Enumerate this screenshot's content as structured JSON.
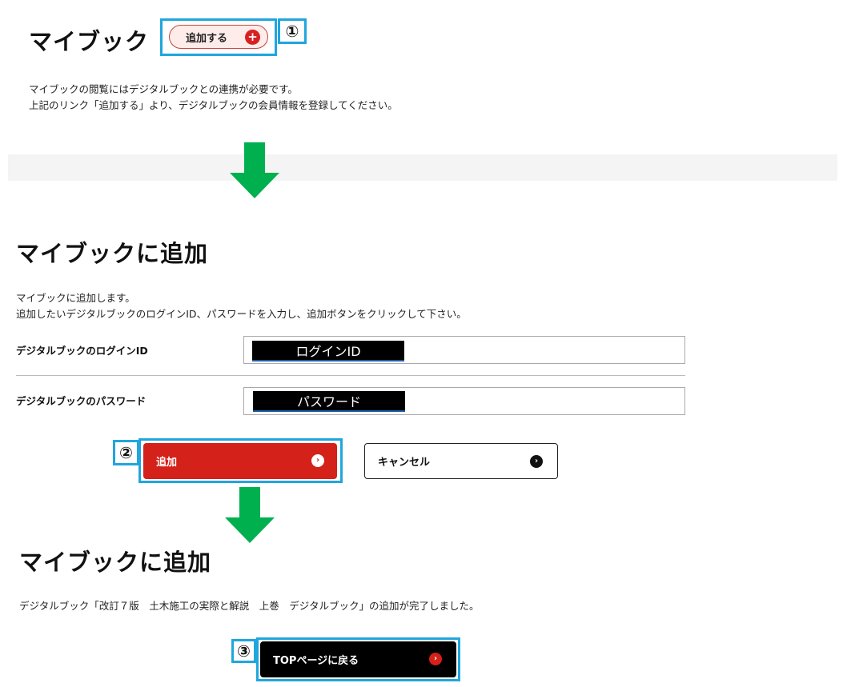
{
  "step1": {
    "title": "マイブック",
    "add_button_label": "追加する",
    "add_icon": "+",
    "description": [
      "マイブックの閲覧にはデジタルブックとの連携が必要です。",
      "上記のリンク「追加する」より、デジタルブックの会員情報を登録してください。"
    ],
    "marker": "①"
  },
  "step2": {
    "title": "マイブックに追加",
    "description": [
      "マイブックに追加します。",
      "追加したいデジタルブックのログインID、パスワードを入力し、追加ボタンをクリックして下さい。"
    ],
    "login_label": "デジタルブックのログインID",
    "login_value": "ログインID",
    "password_label": "デジタルブックのパスワード",
    "password_value": "パスワード",
    "add_button_label": "追加",
    "cancel_button_label": "キャンセル",
    "marker": "②"
  },
  "step3": {
    "title": "マイブックに追加",
    "message": "デジタルブック「改訂７版　土木施工の実際と解説　上巻　デジタルブック」の追加が完了しました。",
    "top_button_label": "TOPページに戻る",
    "marker": "③"
  },
  "colors": {
    "highlight_frame": "#20a6dd",
    "arrow": "#00b04f",
    "primary_red": "#d42119",
    "black": "#000000"
  },
  "icons": {
    "plus": "plus-icon",
    "chevron": "chevron-right-icon",
    "arrow": "down-arrow-icon"
  }
}
